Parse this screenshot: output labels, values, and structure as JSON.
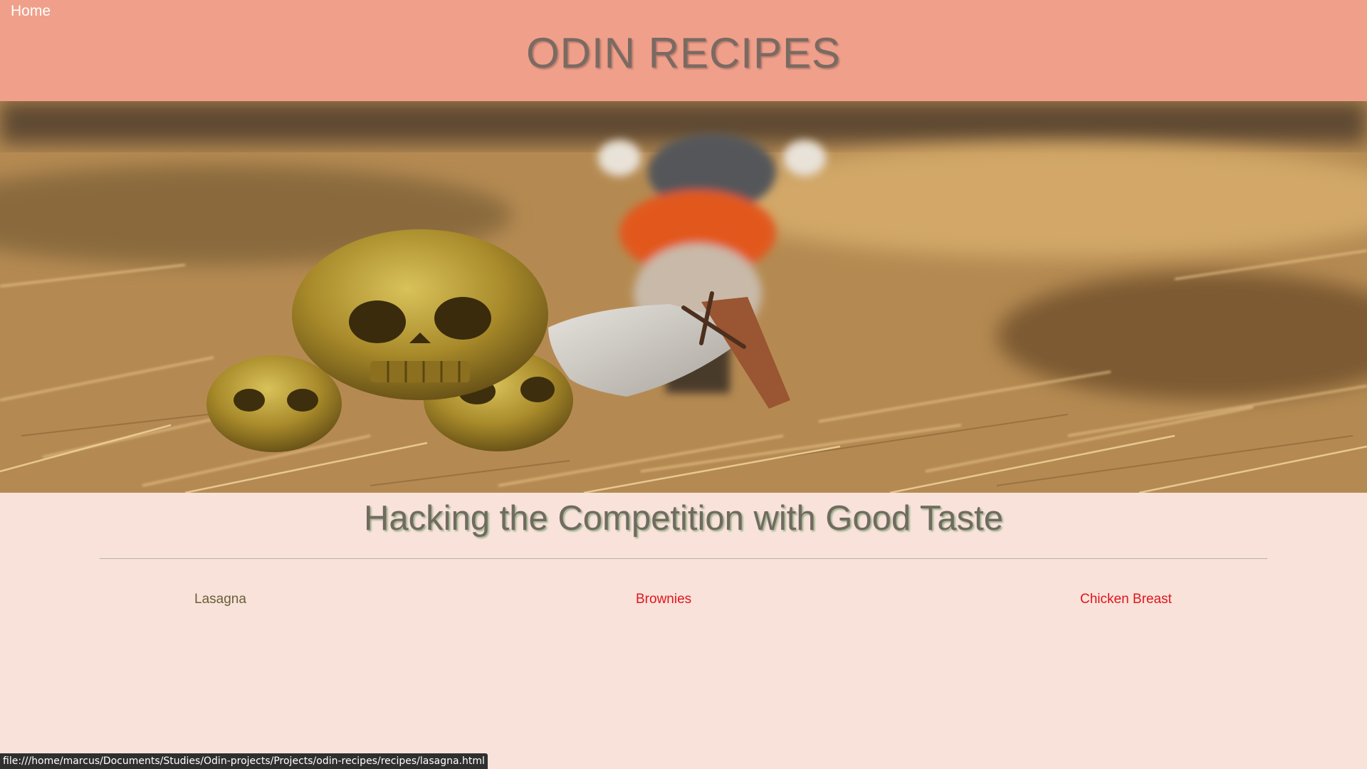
{
  "header": {
    "nav_home_label": "Home",
    "site_title": "ODIN RECIPES"
  },
  "hero": {
    "icon": "viking-skull-axe-photo"
  },
  "main": {
    "tagline": "Hacking the Competition with Good Taste",
    "recipes": [
      {
        "label": "Lasagna"
      },
      {
        "label": "Brownies"
      },
      {
        "label": "Chicken Breast"
      }
    ]
  },
  "status_bar": {
    "url": "file:///home/marcus/Documents/Studies/Odin-projects/Projects/odin-recipes/recipes/lasagna.html"
  },
  "colors": {
    "header_bg": "#f0a08a",
    "page_bg": "#f8e2da",
    "link_visited": "#6b5f36",
    "link_unvisited": "#e0161e"
  }
}
